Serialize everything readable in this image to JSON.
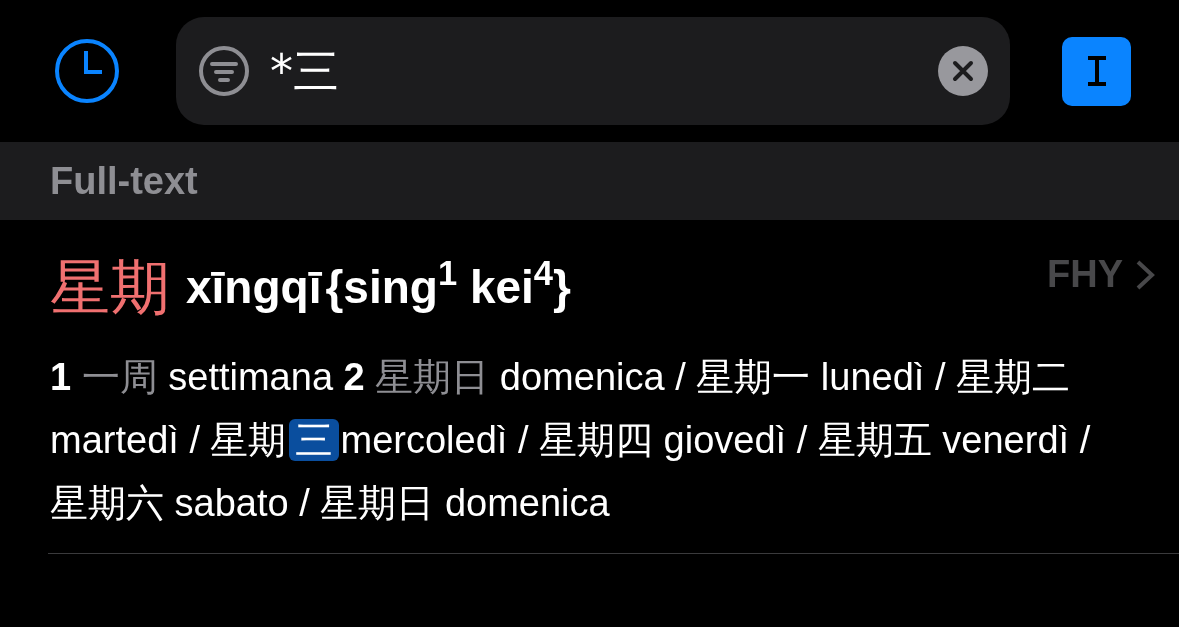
{
  "search": {
    "value": "*三"
  },
  "section": {
    "title": "Full-text"
  },
  "entry": {
    "headword": "星期",
    "pinyin": "xīngqī",
    "jyutping": "{sing$^{1}$ kei$^{4}$}",
    "source": "FHY",
    "definition": [
      {
        "kind": "number",
        "text": "1"
      },
      {
        "kind": "example",
        "text": "一周"
      },
      {
        "kind": "text",
        "text": "settimana"
      },
      {
        "kind": "number",
        "text": "2"
      },
      {
        "kind": "example",
        "text": "星期日"
      },
      {
        "kind": "text",
        "text": "domenica / 星期一 lunedì / 星期二 martedì / 星期"
      },
      {
        "kind": "match",
        "text": "三"
      },
      {
        "kind": "text",
        "text": "mercoledì / 星期四 giovedì / 星期五 venerdì / 星期六 sabato / 星期日 domenica"
      }
    ]
  }
}
